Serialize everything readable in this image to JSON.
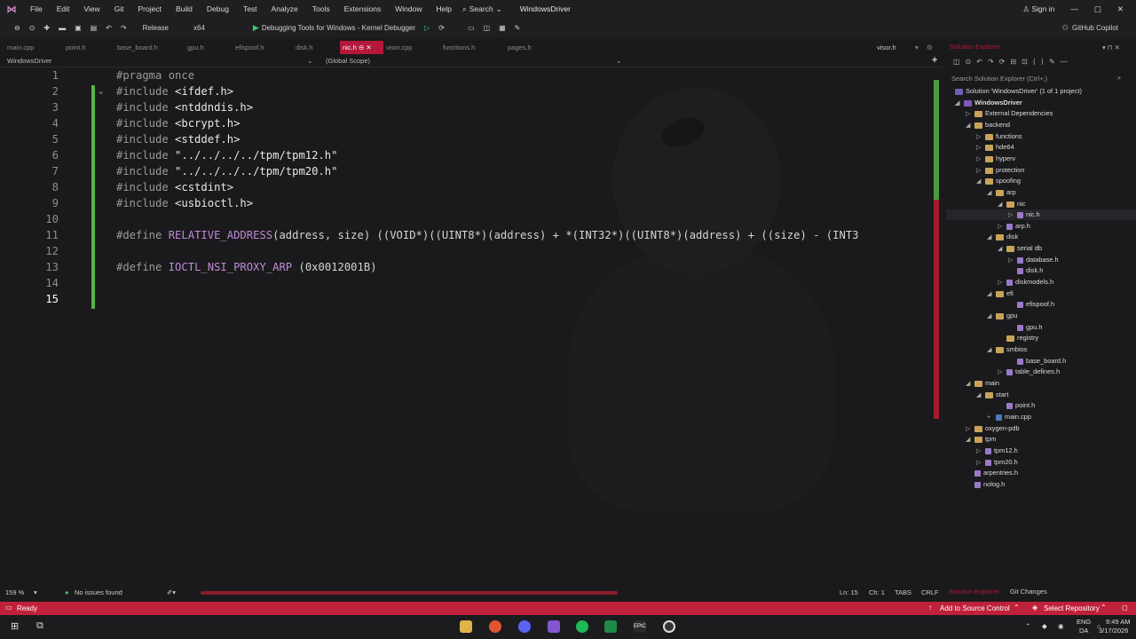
{
  "menu": {
    "items": [
      "File",
      "Edit",
      "View",
      "Git",
      "Project",
      "Build",
      "Debug",
      "Test",
      "Analyze",
      "Tools",
      "Extensions",
      "Window",
      "Help"
    ],
    "search": "Search",
    "title": "WindowsDriver",
    "signin": "Sign in"
  },
  "toolbar": {
    "config": "Release",
    "platform": "x64",
    "debugger": "Debugging Tools for Windows - Kernel Debugger",
    "copilot": "GitHub Copilot"
  },
  "tabs": [
    {
      "label": "main.cpp"
    },
    {
      "label": "point.h"
    },
    {
      "label": "base_board.h"
    },
    {
      "label": "gpu.h"
    },
    {
      "label": "efispoof.h"
    },
    {
      "label": "disk.h"
    },
    {
      "label": "nic.h"
    },
    {
      "label": "visor.cpp"
    },
    {
      "label": "functions.h"
    },
    {
      "label": "pages.h"
    },
    {
      "label": "visor.h"
    }
  ],
  "nav": {
    "project": "WindowsDriver",
    "scope": "(Global Scope)"
  },
  "code": {
    "l1": {
      "num": "1",
      "pp": "#pragma",
      "rest": " once"
    },
    "l2": {
      "num": "2",
      "pp": "#include",
      "rest": " <ifdef.h>"
    },
    "l3": {
      "num": "3",
      "pp": "#include",
      "rest": " <ntddndis.h>"
    },
    "l4": {
      "num": "4",
      "pp": "#include",
      "rest": " <bcrypt.h>"
    },
    "l5": {
      "num": "5",
      "pp": "#include",
      "rest": " <stddef.h>"
    },
    "l6": {
      "num": "6",
      "pp": "#include",
      "rest": " \"../../../../tpm/tpm12.h\""
    },
    "l7": {
      "num": "7",
      "pp": "#include",
      "rest": " \"../../../../tpm/tpm20.h\""
    },
    "l8": {
      "num": "8",
      "pp": "#include",
      "rest": " <cstdint>"
    },
    "l9": {
      "num": "9",
      "pp": "#include",
      "rest": " <usbioctl.h>"
    },
    "l10": {
      "num": "10"
    },
    "l11": {
      "num": "11",
      "pp": "#define",
      "macro": "RELATIVE_ADDRESS",
      "rest": "(address, size) ((VOID*)((UINT8*)(address) + *(INT32*)((UINT8*)(address) + ((size) - (INT3"
    },
    "l12": {
      "num": "12"
    },
    "l13": {
      "num": "13",
      "pp": "#define",
      "macro": "IOCTL_NSI_PROXY_ARP",
      "rest": " (0x0012001B)"
    },
    "l14": {
      "num": "14"
    },
    "l15": {
      "num": "15"
    }
  },
  "solution": {
    "header": "Solution Explorer",
    "search": "Search Solution Explorer (Ctrl+;)",
    "root": "Solution 'WindowsDriver' (1 of 1 project)",
    "items": [
      {
        "label": "WindowsDriver"
      },
      {
        "label": "External Dependencies"
      },
      {
        "label": "backend"
      },
      {
        "label": "functions"
      },
      {
        "label": "hde64"
      },
      {
        "label": "hyperv"
      },
      {
        "label": "protection"
      },
      {
        "label": "spoofing"
      },
      {
        "label": "arp"
      },
      {
        "label": "nic"
      },
      {
        "label": "nic.h"
      },
      {
        "label": "arp.h"
      },
      {
        "label": "disk"
      },
      {
        "label": "serial db"
      },
      {
        "label": "database.h"
      },
      {
        "label": "disk.h"
      },
      {
        "label": "diskmodels.h"
      },
      {
        "label": "efi"
      },
      {
        "label": "efispoof.h"
      },
      {
        "label": "gpu"
      },
      {
        "label": "gpu.h"
      },
      {
        "label": "registry"
      },
      {
        "label": "smbios"
      },
      {
        "label": "base_board.h"
      },
      {
        "label": "table_defines.h"
      },
      {
        "label": "main"
      },
      {
        "label": "start"
      },
      {
        "label": "point.h"
      },
      {
        "label": "main.cpp"
      },
      {
        "label": "oxygen-pdb"
      },
      {
        "label": "tpm"
      },
      {
        "label": "tpm12.h"
      },
      {
        "label": "tpm20.h"
      },
      {
        "label": "arpentries.h"
      },
      {
        "label": "nolog.h"
      }
    ]
  },
  "editor_status": {
    "zoom": "159 %",
    "issues": "No issues found",
    "ln": "Ln: 15",
    "ch": "Ch: 1",
    "tabs": "TABS",
    "eol": "CRLF",
    "sol_tab": "Solution Explorer",
    "git_tab": "Git Changes"
  },
  "status": {
    "ready": "Ready",
    "add_source": "Add to Source Control",
    "select_repo": "Select Repository"
  },
  "taskbar": {
    "lang1": "ENG",
    "lang2": "DA",
    "time": "9:49 AM",
    "date": "3/17/2026"
  }
}
